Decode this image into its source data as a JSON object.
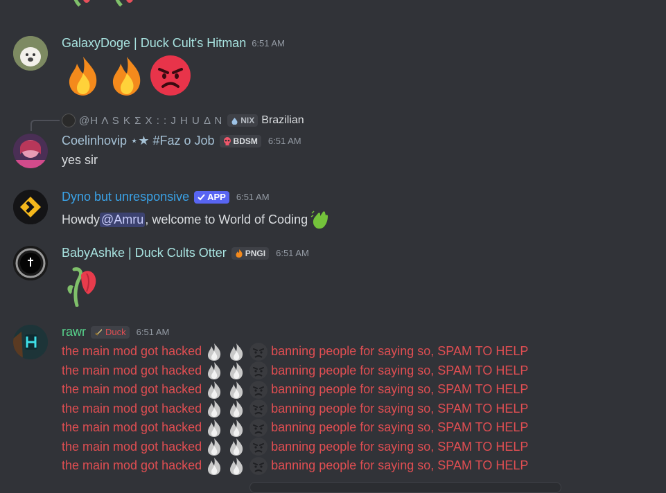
{
  "messages": [
    {
      "author": "GalaxyDoge | Duck Cult's Hitman",
      "time": "6:51 AM",
      "author_color": "#a8e3e0"
    },
    {
      "reply": {
        "author": "@Η Λ S K Σ X : : J H U Δ N",
        "tag": "NIX",
        "text": "Brazilian"
      },
      "author": "Coelinhovip ⋆★ #Faz o Job",
      "tag": "BDSM",
      "time": "6:51 AM",
      "text": "yes sir",
      "author_color": "#a6c2d6"
    },
    {
      "author": "Dyno but unresponsive",
      "tag": "APP",
      "time": "6:51 AM",
      "text_before": "Howdy ",
      "mention": "@Amru",
      "text_after": ", welcome to World of Coding",
      "author_color": "#3aa3e8"
    },
    {
      "author": "BabyAshke | Duck Cults Otter",
      "tag": "PNGI",
      "time": "6:51 AM",
      "author_color": "#a8e3e0"
    },
    {
      "author": "rawr",
      "tag": "Duck",
      "time": "6:51 AM",
      "author_color": "#57d38c",
      "spam_lines": [
        {
          "a": "the main mod got hacked",
          "b": "banning people for saying so, SPAM TO HELP"
        },
        {
          "a": "the main mod got hacked",
          "b": "banning people for saying so, SPAM TO HELP"
        },
        {
          "a": "the main mod got hacked",
          "b": "banning people for saying so, SPAM TO HELP"
        },
        {
          "a": "the main mod got hacked",
          "b": "banning people for saying so, SPAM TO HELP"
        },
        {
          "a": "the main mod got hacked",
          "b": "banning people for saying so, SPAM TO HELP"
        },
        {
          "a": "the main mod got hacked",
          "b": "banning people for saying so, SPAM TO HELP"
        },
        {
          "a": "the main mod got hacked",
          "b": "banning people for saying so, SPAM TO HELP"
        }
      ]
    }
  ],
  "colors": {
    "background": "#313338",
    "spam_red": "#e04e52",
    "app_badge": "#5865f2",
    "timestamp": "#949ba4"
  },
  "icons": [
    "flower-emoji-icon",
    "fire-emoji-icon",
    "angry-face-emoji-icon",
    "wave-hand-emoji-icon",
    "wilted-rose-emoji-icon",
    "sword-icon",
    "skull-icon",
    "drop-icon",
    "check-icon"
  ]
}
